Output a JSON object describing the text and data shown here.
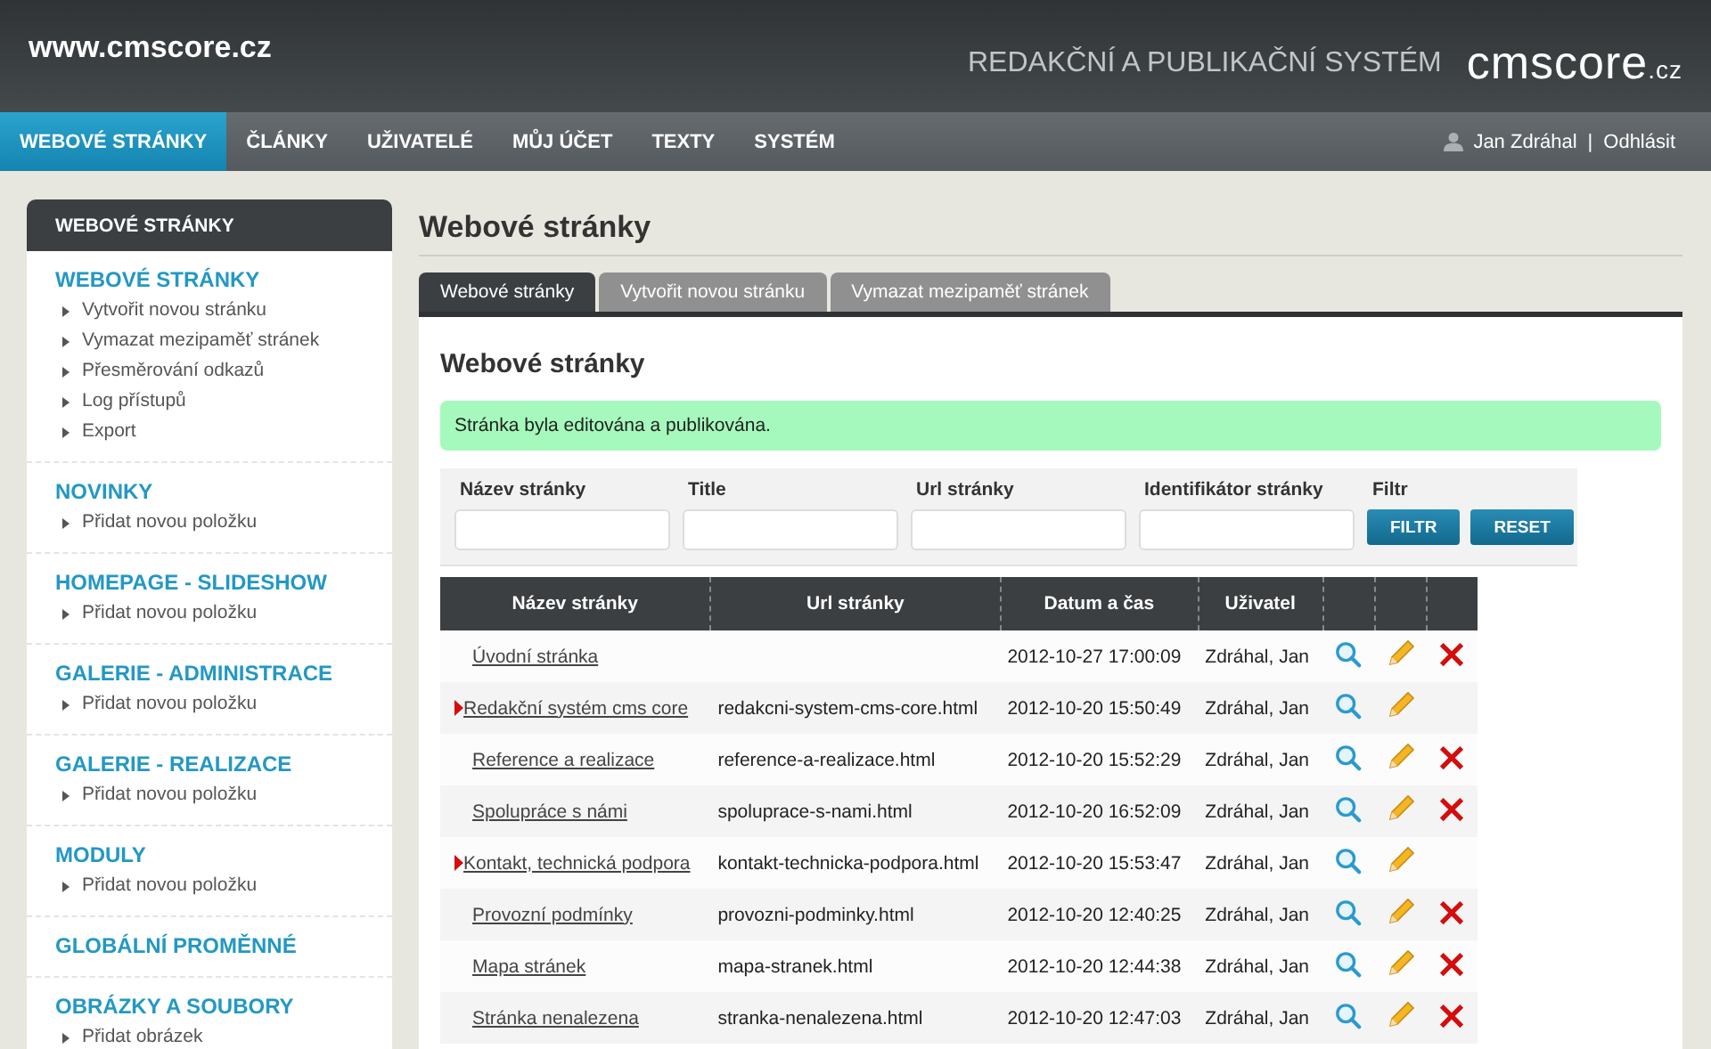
{
  "header": {
    "site": "www.cmscore.cz",
    "tagline": "REDAKČNÍ A PUBLIKAČNÍ SYSTÉM",
    "logo": "cmscore",
    "logo_suffix": ".cz"
  },
  "nav": {
    "items": [
      {
        "label": "WEBOVÉ STRÁNKY",
        "selected": true
      },
      {
        "label": "ČLÁNKY",
        "selected": false
      },
      {
        "label": "UŽIVATELÉ",
        "selected": false
      },
      {
        "label": "MŮJ ÚČET",
        "selected": false
      },
      {
        "label": "TEXTY",
        "selected": false
      },
      {
        "label": "SYSTÉM",
        "selected": false
      }
    ],
    "user": "Jan Zdráhal",
    "separator": "|",
    "logout": "Odhlásit"
  },
  "sidebar": {
    "title": "WEBOVÉ STRÁNKY",
    "sections": [
      {
        "title": "WEBOVÉ STRÁNKY",
        "items": [
          "Vytvořit novou stránku",
          "Vymazat mezipaměť stránek",
          "Přesměrování odkazů",
          "Log přístupů",
          "Export"
        ]
      },
      {
        "title": "NOVINKY",
        "items": [
          "Přidat novou položku"
        ]
      },
      {
        "title": "HOMEPAGE - SLIDESHOW",
        "items": [
          "Přidat novou položku"
        ]
      },
      {
        "title": "GALERIE - ADMINISTRACE",
        "items": [
          "Přidat novou položku"
        ]
      },
      {
        "title": "GALERIE - REALIZACE",
        "items": [
          "Přidat novou položku"
        ]
      },
      {
        "title": "MODULY",
        "items": [
          "Přidat novou položku"
        ]
      },
      {
        "title": "GLOBÁLNÍ PROMĚNNÉ"
      },
      {
        "title": "OBRÁZKY A SOUBORY",
        "items": [
          "Přidat obrázek"
        ]
      }
    ]
  },
  "main": {
    "title": "Webové stránky",
    "tabs": [
      {
        "label": "Webové stránky",
        "selected": true
      },
      {
        "label": "Vytvořit novou stránku",
        "selected": false
      },
      {
        "label": "Vymazat mezipaměť stránek",
        "selected": false
      }
    ],
    "heading": "Webové stránky",
    "alert": "Stránka byla editována a publikována.",
    "filter": {
      "fields": [
        "Název stránky",
        "Title",
        "Url stránky",
        "Identifikátor stránky"
      ],
      "buttons_label": "Filtr",
      "buttons": [
        "FILTR",
        "RESET"
      ]
    },
    "table": {
      "columns": [
        "Název stránky",
        "Url stránky",
        "Datum a čas",
        "Uživatel"
      ],
      "rows": [
        {
          "name": "Úvodní stránka",
          "date": "2012-10-27 17:00:09",
          "user": "Zdráhal, Jan",
          "expandable": false,
          "deletable": true
        },
        {
          "name": "Redakční systém cms core",
          "url": "redakcni-system-cms-core.html",
          "date": "2012-10-20 15:50:49",
          "user": "Zdráhal, Jan",
          "expandable": true,
          "deletable": false
        },
        {
          "name": "Reference a realizace",
          "url": "reference-a-realizace.html",
          "date": "2012-10-20 15:52:29",
          "user": "Zdráhal, Jan",
          "expandable": false,
          "deletable": true
        },
        {
          "name": "Spolupráce s námi",
          "url": "spoluprace-s-nami.html",
          "date": "2012-10-20 16:52:09",
          "user": "Zdráhal, Jan",
          "expandable": false,
          "deletable": true
        },
        {
          "name": "Kontakt, technická podpora",
          "url": "kontakt-technicka-podpora.html",
          "date": "2012-10-20 15:53:47",
          "user": "Zdráhal, Jan",
          "expandable": true,
          "deletable": false
        },
        {
          "name": "Provozní podmínky",
          "url": "provozni-podminky.html",
          "date": "2012-10-20 12:40:25",
          "user": "Zdráhal, Jan",
          "expandable": false,
          "deletable": true
        },
        {
          "name": "Mapa stránek",
          "url": "mapa-stranek.html",
          "date": "2012-10-20 12:44:38",
          "user": "Zdráhal, Jan",
          "expandable": false,
          "deletable": true
        },
        {
          "name": "Stránka nenalezena",
          "url": "stranka-nenalezena.html",
          "date": "2012-10-20 12:47:03",
          "user": "Zdráhal, Jan",
          "expandable": false,
          "deletable": true
        }
      ]
    }
  }
}
